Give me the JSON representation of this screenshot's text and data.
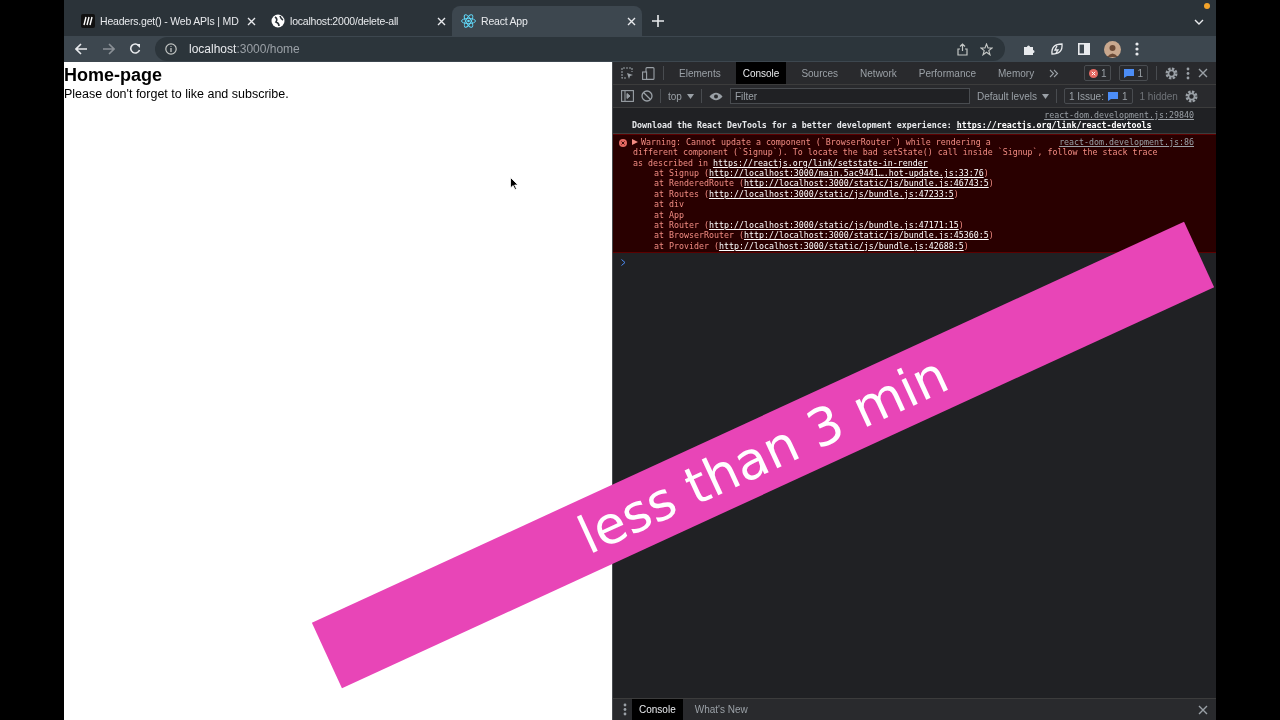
{
  "browser": {
    "tabs": [
      {
        "title": "Headers.get() - Web APIs | MD",
        "kind": "mdn",
        "selected": false
      },
      {
        "title": "localhost:2000/delete-all",
        "kind": "globe",
        "selected": false
      },
      {
        "title": "React App",
        "kind": "atom",
        "selected": true
      }
    ],
    "address": {
      "host": "localhost",
      "rest": ":3000/home"
    }
  },
  "page": {
    "heading": "Home-page",
    "text": "Please don't forget to like and subscribe."
  },
  "devtools": {
    "tabs": [
      {
        "label": "Elements",
        "selected": false
      },
      {
        "label": "Console",
        "selected": true
      },
      {
        "label": "Sources",
        "selected": false
      },
      {
        "label": "Network",
        "selected": false
      },
      {
        "label": "Performance",
        "selected": false
      },
      {
        "label": "Memory",
        "selected": false
      }
    ],
    "error_count": "1",
    "message_count": "1",
    "toolbar": {
      "context": "top",
      "filter_placeholder": "Filter",
      "levels": "Default levels",
      "issues_label": "1 Issue:",
      "issues_count": "1",
      "hidden": "1 hidden"
    },
    "messages": [
      {
        "kind": "info",
        "source": "react-dom.development.js:29840",
        "text": "Download the React DevTools for a better development experience: ",
        "link": "https://reactjs.org/link/react-devtools"
      },
      {
        "kind": "error",
        "source": "react-dom.development.js:86",
        "expanded": false,
        "lines": [
          {
            "text": "Warning: Cannot update a component (`BrowserRouter`) while rendering a"
          },
          {
            "text": "different component (`Signup`). To locate the bad setState() call inside `Signup`, follow the stack trace"
          },
          {
            "text": "as described in ",
            "link": "https://reactjs.org/link/setstate-in-render"
          }
        ],
        "stack": [
          {
            "text": "at Signup (",
            "link": "http://localhost:3000/main.5ac9441….hot-update.js:33:76",
            "after": ")"
          },
          {
            "text": "at RenderedRoute (",
            "link": "http://localhost:3000/static/js/bundle.js:46743:5",
            "after": ")"
          },
          {
            "text": "at Routes (",
            "link": "http://localhost:3000/static/js/bundle.js:47233:5",
            "after": ")"
          },
          {
            "text": "at div"
          },
          {
            "text": "at App"
          },
          {
            "text": "at Router (",
            "link": "http://localhost:3000/static/js/bundle.js:47171:15",
            "after": ")"
          },
          {
            "text": "at BrowserRouter (",
            "link": "http://localhost:3000/static/js/bundle.js:45360:5",
            "after": ")"
          },
          {
            "text": "at Provider (",
            "link": "http://localhost:3000/static/js/bundle.js:42688:5",
            "after": ")"
          }
        ]
      }
    ],
    "drawer_tabs": [
      {
        "label": "Console",
        "selected": true
      },
      {
        "label": "What's New",
        "selected": false
      }
    ]
  },
  "overlay": {
    "text": "less than 3 min"
  }
}
